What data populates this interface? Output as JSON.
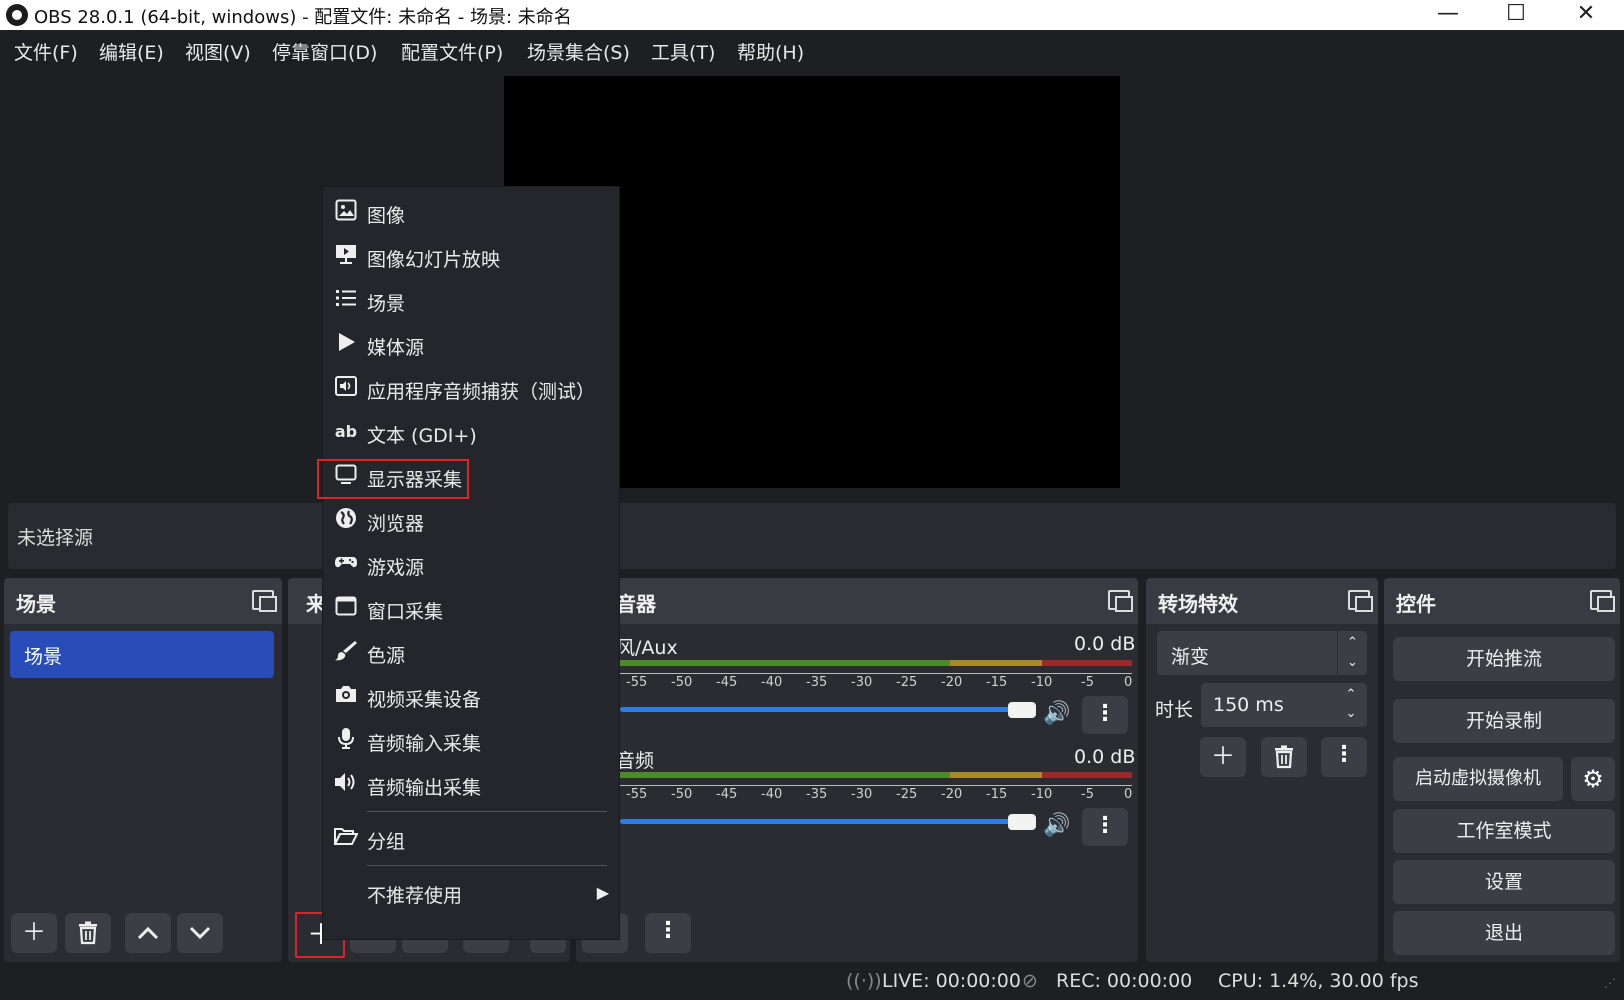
{
  "window": {
    "title": "OBS 28.0.1 (64-bit, windows) - 配置文件: 未命名 - 场景: 未命名",
    "minimize": "—",
    "maximize": "☐",
    "close": "✕"
  },
  "menubar": [
    "文件(F)",
    "编辑(E)",
    "视图(V)",
    "停靠窗口(D)",
    "配置文件(P)",
    "场景集合(S)",
    "工具(T)",
    "帮助(H)"
  ],
  "source_info": "未选择源",
  "scenes": {
    "title": "场景",
    "items": [
      "场景"
    ]
  },
  "sources": {
    "title_partial": "来"
  },
  "mixer": {
    "title_partial": "音器",
    "channels": [
      {
        "name_partial": "风/Aux",
        "db": "0.0 dB"
      },
      {
        "name_partial": "音频",
        "db": "0.0 dB"
      }
    ],
    "ticks": [
      "-55",
      "-50",
      "-45",
      "-40",
      "-35",
      "-30",
      "-25",
      "-20",
      "-15",
      "-10",
      "-5",
      "0"
    ]
  },
  "transitions": {
    "title": "转场特效",
    "type": "渐变",
    "duration_label": "时长",
    "duration": "150 ms"
  },
  "controls": {
    "title": "控件",
    "start_stream": "开始推流",
    "start_record": "开始录制",
    "virtual_cam": "启动虚拟摄像机",
    "studio_mode": "工作室模式",
    "settings": "设置",
    "exit": "退出"
  },
  "statusbar": {
    "live": "LIVE: 00:00:00",
    "rec": "REC: 00:00:00",
    "cpu": "CPU: 1.4%, 30.00 fps"
  },
  "context_menu": {
    "items": [
      {
        "label": "图像",
        "icon": "image-icon"
      },
      {
        "label": "图像幻灯片放映",
        "icon": "slideshow-icon"
      },
      {
        "label": "场景",
        "icon": "list-icon"
      },
      {
        "label": "媒体源",
        "icon": "play-icon"
      },
      {
        "label": "应用程序音频捕获（测试）",
        "icon": "app-audio-icon"
      },
      {
        "label": "文本 (GDI+)",
        "icon": "text-icon"
      },
      {
        "label": "显示器采集",
        "icon": "monitor-icon"
      },
      {
        "label": "浏览器",
        "icon": "globe-icon"
      },
      {
        "label": "游戏源",
        "icon": "gamepad-icon"
      },
      {
        "label": "窗口采集",
        "icon": "window-icon"
      },
      {
        "label": "色源",
        "icon": "brush-icon"
      },
      {
        "label": "视频采集设备",
        "icon": "camera-icon"
      },
      {
        "label": "音频输入采集",
        "icon": "microphone-icon"
      },
      {
        "label": "音频输出采集",
        "icon": "speaker-icon"
      }
    ],
    "group": "分组",
    "deprecated": "不推荐使用",
    "highlighted": "显示器采集"
  },
  "colors": {
    "accent": "#284cb8",
    "highlight_box": "#e0202a",
    "meter_green": "#4c8a2a",
    "meter_yellow": "#a88a2a",
    "meter_red": "#9a2a2a"
  }
}
